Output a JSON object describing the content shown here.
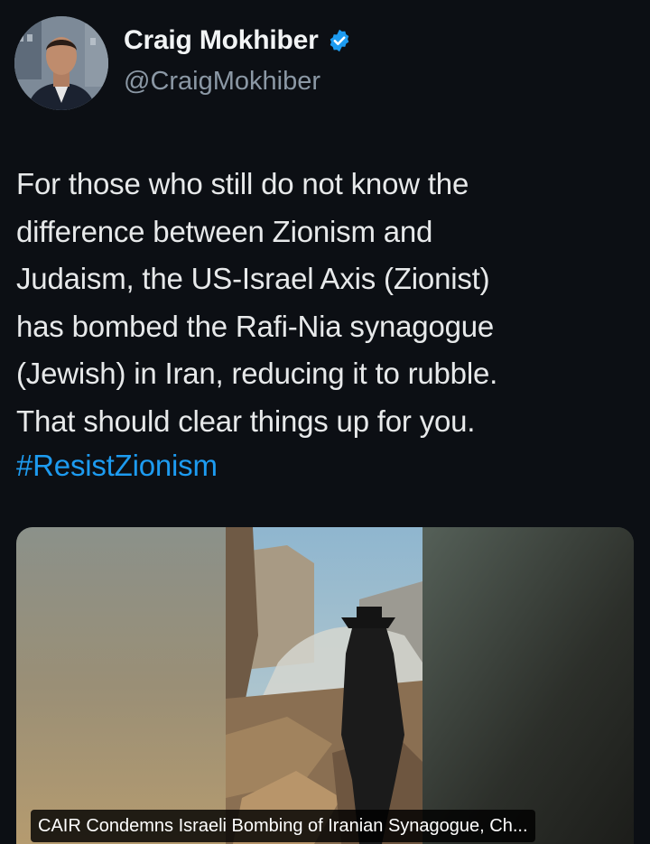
{
  "author": {
    "display_name": "Craig Mokhiber",
    "handle": "@CraigMokhiber",
    "verified": true,
    "verified_color": "#1d9bf0"
  },
  "tweet": {
    "text": "For those who still do not know the\ndifference between Zionism and\nJudaism, the US-Israel Axis (Zionist)\nhas bombed the Rafi-Nia synagogue\n(Jewish) in Iran, reducing it to rubble.\nThat should clear things up for you.",
    "hashtag": "#ResistZionism",
    "hashtag_color": "#1d9bf0"
  },
  "media": {
    "caption": "CAIR Condemns Israeli Bombing of Iranian Synagogue, Ch..."
  },
  "theme": {
    "background": "#0c0f14",
    "text": "#e7e9ea",
    "muted_text": "#8b98a5"
  }
}
